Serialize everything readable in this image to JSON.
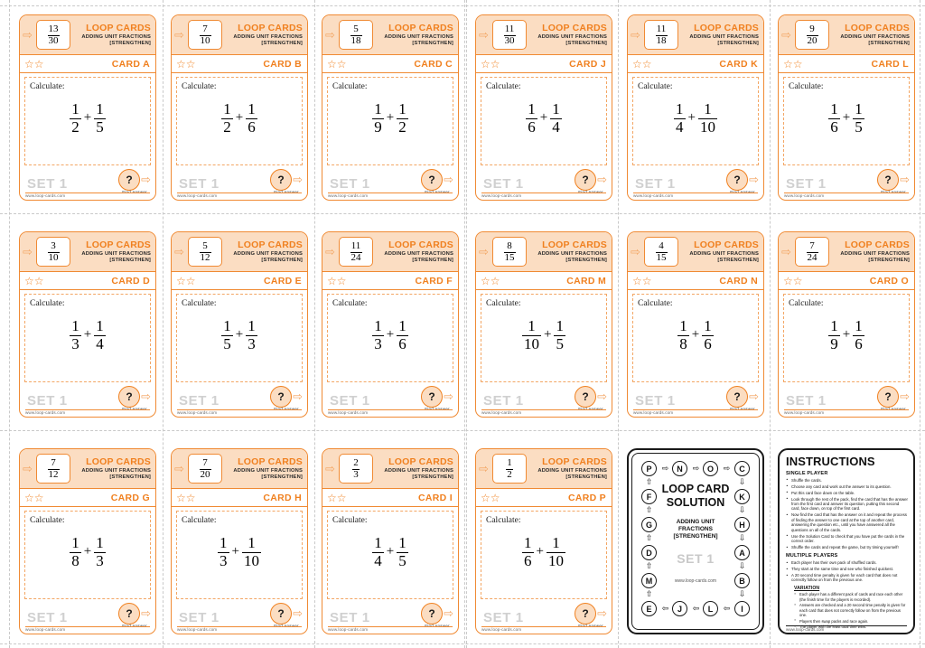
{
  "sheet": {
    "brand_title": "LOOP CARDS",
    "brand_sub_line1": "ADDING UNIT FRACTIONS",
    "brand_sub_line2": "[STRENGTHEN]",
    "stars": "☆☆",
    "calculate_label": "Calculate:",
    "set_label": "SET 1",
    "find_answer_label": "Find Answer",
    "url": "www.loop-cards.com",
    "question_mark": "?",
    "in_arrow": "⇨",
    "out_arrow": "⇨",
    "accent_color": "#f0801f",
    "header_fill": "#fbddc2",
    "border_color": "#f08a33",
    "set_gray": "#d0d0d0"
  },
  "cards": [
    {
      "id": "CARD A",
      "answer_num": "13",
      "answer_den": "30",
      "q1_num": "1",
      "q1_den": "2",
      "q2_num": "1",
      "q2_den": "5"
    },
    {
      "id": "CARD B",
      "answer_num": "7",
      "answer_den": "10",
      "q1_num": "1",
      "q1_den": "2",
      "q2_num": "1",
      "q2_den": "6"
    },
    {
      "id": "CARD C",
      "answer_num": "5",
      "answer_den": "18",
      "q1_num": "1",
      "q1_den": "9",
      "q2_num": "1",
      "q2_den": "2"
    },
    {
      "id": "CARD D",
      "answer_num": "3",
      "answer_den": "10",
      "q1_num": "1",
      "q1_den": "3",
      "q2_num": "1",
      "q2_den": "4"
    },
    {
      "id": "CARD E",
      "answer_num": "5",
      "answer_den": "12",
      "q1_num": "1",
      "q1_den": "5",
      "q2_num": "1",
      "q2_den": "3"
    },
    {
      "id": "CARD F",
      "answer_num": "11",
      "answer_den": "24",
      "q1_num": "1",
      "q1_den": "3",
      "q2_num": "1",
      "q2_den": "6"
    },
    {
      "id": "CARD G",
      "answer_num": "7",
      "answer_den": "12",
      "q1_num": "1",
      "q1_den": "8",
      "q2_num": "1",
      "q2_den": "3"
    },
    {
      "id": "CARD H",
      "answer_num": "7",
      "answer_den": "20",
      "q1_num": "1",
      "q1_den": "3",
      "q2_num": "1",
      "q2_den": "10"
    },
    {
      "id": "CARD I",
      "answer_num": "2",
      "answer_den": "3",
      "q1_num": "1",
      "q1_den": "4",
      "q2_num": "1",
      "q2_den": "5"
    },
    {
      "id": "CARD J",
      "answer_num": "11",
      "answer_den": "30",
      "q1_num": "1",
      "q1_den": "6",
      "q2_num": "1",
      "q2_den": "4"
    },
    {
      "id": "CARD K",
      "answer_num": "11",
      "answer_den": "18",
      "q1_num": "1",
      "q1_den": "4",
      "q2_num": "1",
      "q2_den": "10"
    },
    {
      "id": "CARD L",
      "answer_num": "9",
      "answer_den": "20",
      "q1_num": "1",
      "q1_den": "6",
      "q2_num": "1",
      "q2_den": "5"
    },
    {
      "id": "CARD M",
      "answer_num": "8",
      "answer_den": "15",
      "q1_num": "1",
      "q1_den": "10",
      "q2_num": "1",
      "q2_den": "5"
    },
    {
      "id": "CARD N",
      "answer_num": "4",
      "answer_den": "15",
      "q1_num": "1",
      "q1_den": "8",
      "q2_num": "1",
      "q2_den": "6"
    },
    {
      "id": "CARD O",
      "answer_num": "7",
      "answer_den": "24",
      "q1_num": "1",
      "q1_den": "9",
      "q2_num": "1",
      "q2_den": "6"
    },
    {
      "id": "CARD P",
      "answer_num": "1",
      "answer_den": "2",
      "q1_num": "1",
      "q1_den": "6",
      "q2_num": "1",
      "q2_den": "10"
    }
  ],
  "plus_sign": "+",
  "solution_card": {
    "title_line1": "LOOP CARD",
    "title_line2": "SOLUTION",
    "sub_line1": "ADDING UNIT",
    "sub_line2": "FRACTIONS",
    "sub_line3": "[STRENGTHEN]",
    "set_label": "SET 1",
    "url": "www.loop-cards.com",
    "top_row": [
      "P",
      "N",
      "O",
      "C"
    ],
    "right_col": [
      "K",
      "H",
      "A",
      "B"
    ],
    "bottom_row": [
      "I",
      "L",
      "J",
      "E"
    ],
    "left_col": [
      "M",
      "D",
      "G",
      "F"
    ],
    "arrow_right": "⇨",
    "arrow_left": "⇦",
    "arrow_down": "⇩",
    "arrow_up": "⇧"
  },
  "instructions": {
    "title": "INSTRUCTIONS",
    "single_player_heading": "SINGLE PLAYER",
    "single_player_items": [
      "Shuffle the cards.",
      "Choose any card and work out the answer to its question.",
      "Put this card face down on the table.",
      "Look through the rest of the pack, find the card that has the answer from the first card and answer its question, putting this second card, face down, on top of the first card.",
      "Now find the card that has the answer on it and repeat the process of finding the answer to one card at the top of another card, answering the question etc., until you have answered all the questions on all of the cards.",
      "Use the Solution Card to check that you have put the cards in the correct order.",
      "Shuffle the cards and repeat the game, but try timing yourself!"
    ],
    "multiple_players_heading": "MULTIPLE PLAYERS",
    "multiple_players_items": [
      "Each player has their own pack of shuffled cards.",
      "They start at the same time and see who finished quickest.",
      "A 20 second time penalty is given for each card that does not correctly follow on from the previous one."
    ],
    "variation_heading": "VARIATION",
    "variation_items": [
      "Each player has a different pack of cards and race each other (the finish time for the players is recorded).",
      "Answers are checked and a 20 second time penalty is given for each card that does not correctly follow on from the previous one.",
      "Players then swap packs and race again.",
      "The player with the least total time wins."
    ],
    "url": "www.loop-cards.com"
  }
}
